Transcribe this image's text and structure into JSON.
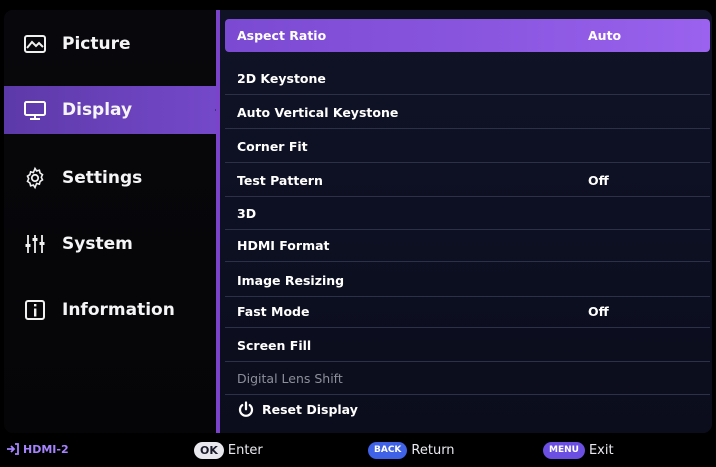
{
  "sidebar": {
    "items": [
      {
        "label": "Picture",
        "icon": "picture-icon",
        "active": false
      },
      {
        "label": "Display",
        "icon": "monitor-icon",
        "active": true
      },
      {
        "label": "Settings",
        "icon": "gear-icon",
        "active": false
      },
      {
        "label": "System",
        "icon": "sliders-icon",
        "active": false
      },
      {
        "label": "Information",
        "icon": "info-icon",
        "active": false
      }
    ]
  },
  "menu": {
    "rows": [
      {
        "label": "Aspect Ratio",
        "value": "Auto"
      },
      {
        "label": "2D Keystone",
        "value": ""
      },
      {
        "label": "Auto Vertical Keystone",
        "value": ""
      },
      {
        "label": "Corner Fit",
        "value": ""
      },
      {
        "label": "Test Pattern",
        "value": "Off"
      },
      {
        "label": "3D",
        "value": ""
      },
      {
        "label": "HDMI Format",
        "value": ""
      },
      {
        "label": "Image Resizing",
        "value": ""
      },
      {
        "label": "Fast Mode",
        "value": "Off"
      },
      {
        "label": "Screen Fill",
        "value": ""
      },
      {
        "label": "Digital Lens Shift",
        "value": ""
      },
      {
        "label": "Reset Display",
        "value": ""
      }
    ]
  },
  "footer": {
    "source": "HDMI-2",
    "ok_key": "OK",
    "ok_label": "Enter",
    "back_key": "BACK",
    "back_label": "Return",
    "menu_key": "MENU",
    "menu_label": "Exit"
  },
  "colors": {
    "accent": "#7b4ad2",
    "active_nav": "#5c39a8",
    "divider": "#7a43c9"
  }
}
